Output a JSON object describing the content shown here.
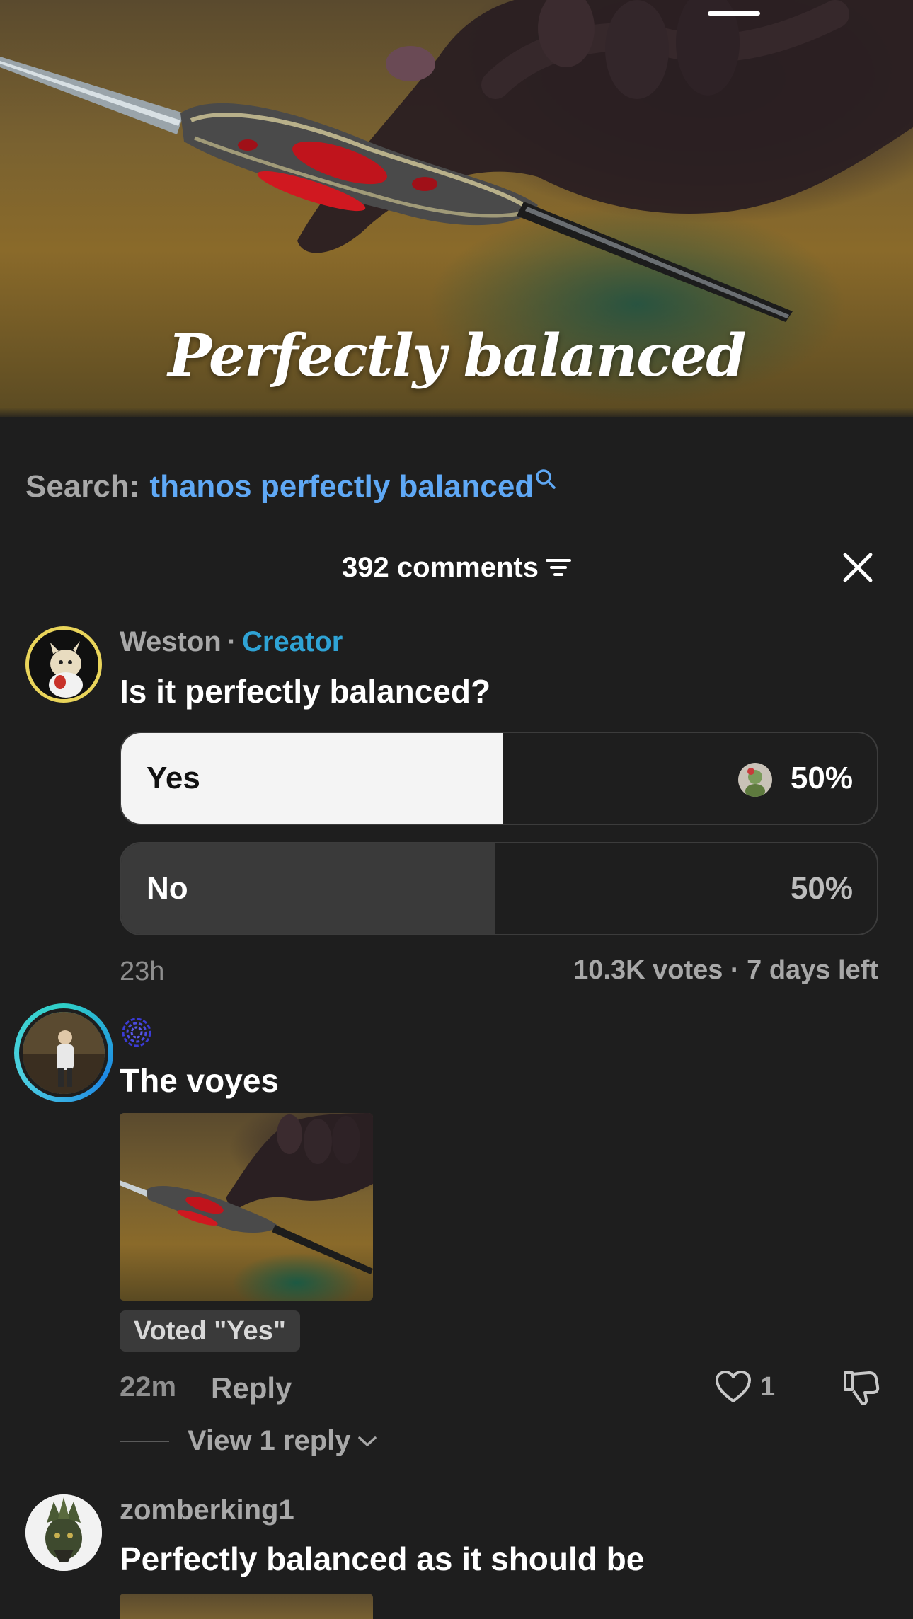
{
  "video": {
    "caption": "Perfectly balanced"
  },
  "search": {
    "prefix": "Search:",
    "query": "thanos perfectly balanced"
  },
  "comments_header": {
    "title": "392 comments"
  },
  "poll": {
    "username": "Weston",
    "separator": "·",
    "creator_badge": "Creator",
    "question": "Is it perfectly balanced?",
    "options": [
      {
        "label": "Yes",
        "percent_text": "50%",
        "fill_fraction": 0.505,
        "selected": true
      },
      {
        "label": "No",
        "percent_text": "50%",
        "fill_fraction": 0.495,
        "selected": false
      }
    ],
    "time": "23h",
    "stats": "10.3K votes · 7 days left"
  },
  "comments": [
    {
      "text": "The voyes",
      "vote_badge": "Voted \"Yes\"",
      "time": "22m",
      "reply_label": "Reply",
      "like_count": "1",
      "view_replies": "View 1 reply"
    },
    {
      "username": "zomberking1",
      "text": "Perfectly balanced as it should be"
    }
  ],
  "colors": {
    "background": "#1e1e1e",
    "search_link": "#5fa8f5",
    "creator_badge": "#2fa3d5",
    "muted_text": "#a8a8a8"
  }
}
